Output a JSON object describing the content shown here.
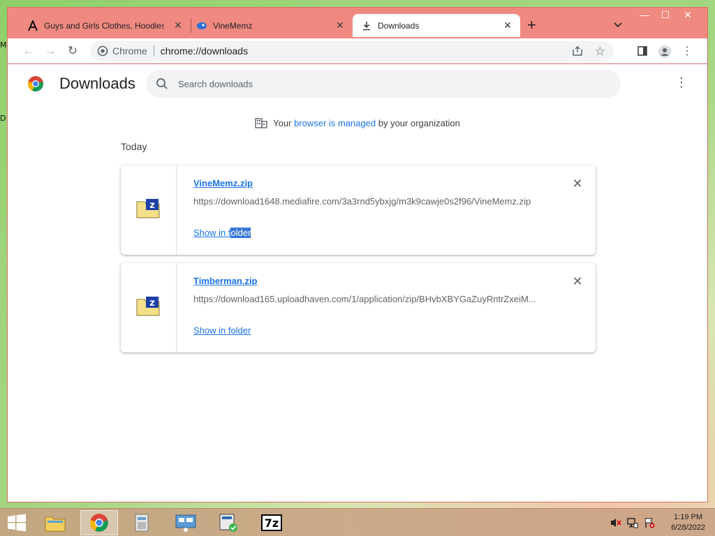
{
  "desktop": {
    "fragments": [
      "M",
      "D"
    ]
  },
  "browser": {
    "tabs": [
      {
        "title": "Guys and Girls Clothes, Hoodies",
        "favicon": "a-letter-icon"
      },
      {
        "title": "VineMemz",
        "favicon": "vinememz-icon"
      },
      {
        "title": "Downloads",
        "favicon": "download-icon",
        "active": true
      }
    ],
    "new_tab": "+",
    "window_controls": {
      "minimize": "—",
      "maximize": "☐",
      "close": "✕"
    },
    "toolbar": {
      "omnibox_site": "Chrome",
      "omnibox_url": "chrome://downloads"
    }
  },
  "downloads": {
    "title": "Downloads",
    "search_placeholder": "Search downloads",
    "managed": {
      "prefix": "Your ",
      "link": "browser is managed",
      "suffix": " by your organization"
    },
    "section_label": "Today",
    "items": [
      {
        "name": "VineMemz.zip",
        "url": "https://download1648.mediafire.com/3a3rnd5ybxjg/m3k9cawje0s2f96/VineMemz.zip",
        "action_pre": "Show in f",
        "action_sel": "older"
      },
      {
        "name": "Timberman.zip",
        "url": "https://download165.uploadhaven.com/1/application/zip/BHvbXBYGaZuyRntrZxeiM...",
        "action": "Show in folder"
      }
    ]
  },
  "taskbar": {
    "apps": [
      "windows-start-icon",
      "file-explorer-icon",
      "chrome-icon",
      "control-panel-icon",
      "system-icon",
      "security-icon",
      "7zip-icon"
    ],
    "tray_icons": [
      "volume-muted-icon",
      "network-icon",
      "action-center-icon"
    ],
    "time": "1:19 PM",
    "date": "6/28/2022"
  },
  "colors": {
    "accent": "#1a73e8",
    "frame": "#f08a80"
  }
}
